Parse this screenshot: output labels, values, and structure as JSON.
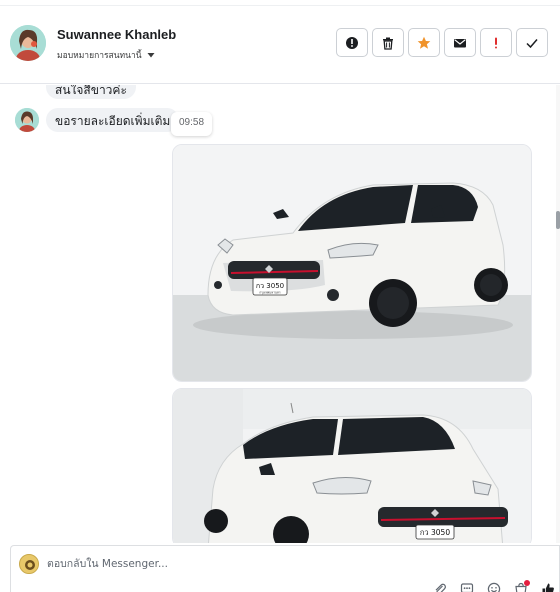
{
  "contact": {
    "name": "Suwannee Khanleb"
  },
  "assign": {
    "label": "มอบหมายการสนทนานี้"
  },
  "messages": [
    {
      "text": "สนใจสีขาวค่ะ"
    },
    {
      "text": "ขอรายละเอียดเพิ่มเติม",
      "time": "09:58"
    }
  ],
  "photos": [
    {
      "plate_line1": "กว 3050",
      "plate_line2": "กรุงเทพมหานคร",
      "car_color": "#f4f4f2",
      "accent_color": "#c8102e"
    },
    {
      "plate_line1": "กว 3050",
      "car_color": "#f4f4f2",
      "accent_color": "#c8102e"
    }
  ],
  "composer": {
    "placeholder": "ตอบกลับใน Messenger..."
  },
  "icons": {
    "actions": [
      "alert-icon",
      "trash-icon",
      "star-icon",
      "mail-icon",
      "exclamation-icon",
      "check-icon"
    ],
    "tools": [
      "paperclip-icon",
      "saved-reply-icon",
      "emoji-icon",
      "shop-icon",
      "thumbs-up-icon"
    ]
  },
  "colors": {
    "star": "#f0932b",
    "exclamation": "#e02e2e",
    "dot": "#e41e3f"
  }
}
